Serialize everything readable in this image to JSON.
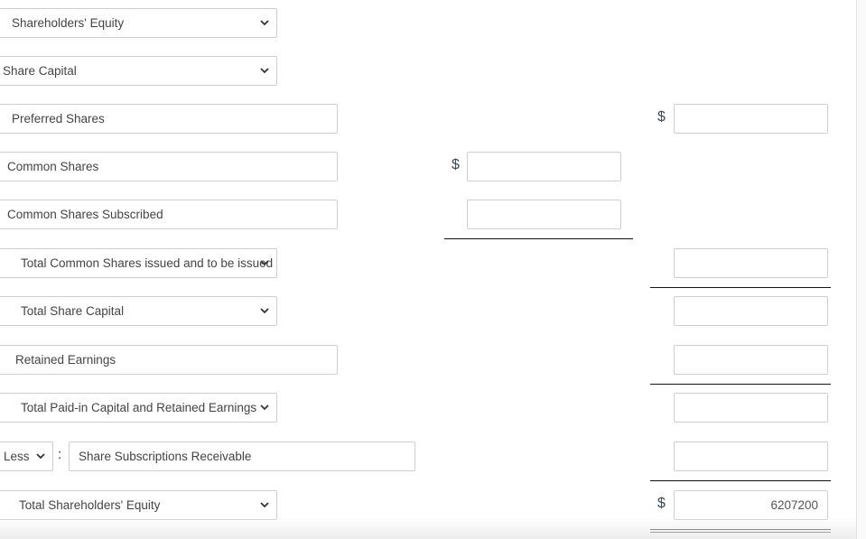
{
  "rows": {
    "shareholders_equity": {
      "label": "Shareholders' Equity"
    },
    "share_capital": {
      "label": "Share Capital"
    },
    "preferred_shares": {
      "label": "Preferred Shares",
      "amount": ""
    },
    "common_shares": {
      "label": "Common Shares",
      "amount": ""
    },
    "common_shares_subscribed": {
      "label": "Common Shares Subscribed",
      "amount": ""
    },
    "total_common_shares": {
      "label": "Total Common Shares issued and to be issued",
      "amount": ""
    },
    "total_share_capital": {
      "label": "Total Share Capital",
      "amount": ""
    },
    "retained_earnings": {
      "label": "Retained Earnings",
      "amount": ""
    },
    "total_paid_in": {
      "label": "Total Paid-in Capital and Retained Earnings",
      "amount": ""
    },
    "less_row": {
      "operator": "Less",
      "label": "Share Subscriptions Receivable",
      "amount": ""
    },
    "total_shareholders_equity": {
      "label": "Total Shareholders' Equity",
      "amount": "6207200"
    }
  },
  "currency_symbol": "$",
  "colon": ":"
}
